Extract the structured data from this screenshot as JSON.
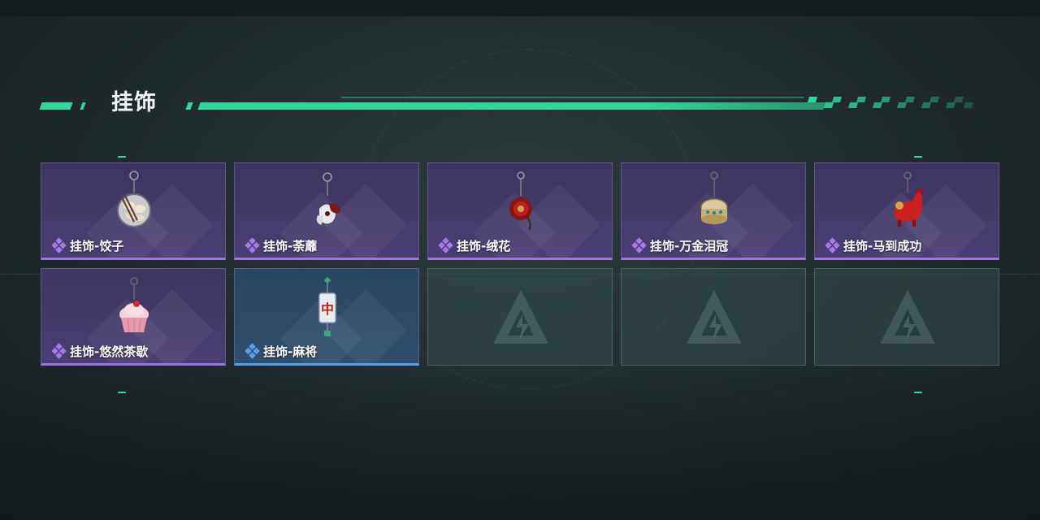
{
  "section": {
    "title": "挂饰"
  },
  "colors": {
    "accent": "#2fd89a",
    "rarity_purple": "#a072e0",
    "rarity_blue": "#5aa0e6"
  },
  "items": [
    {
      "label": "挂饰-饺子",
      "rarity": "purple",
      "icon": "dumpling-charm-icon"
    },
    {
      "label": "挂饰-荼蘼",
      "rarity": "purple",
      "icon": "flower-charm-icon"
    },
    {
      "label": "挂饰-绒花",
      "rarity": "purple",
      "icon": "velvet-flower-charm-icon"
    },
    {
      "label": "挂饰-万金泪冠",
      "rarity": "purple",
      "icon": "tear-crown-charm-icon"
    },
    {
      "label": "挂饰-马到成功",
      "rarity": "purple",
      "icon": "horse-charm-icon"
    },
    {
      "label": "挂饰-悠然茶歇",
      "rarity": "purple",
      "icon": "cupcake-charm-icon"
    },
    {
      "label": "挂饰-麻将",
      "rarity": "blue",
      "icon": "mahjong-charm-icon"
    }
  ],
  "empty_slots": 3,
  "empty_slot_icon": "game-logo-icon"
}
